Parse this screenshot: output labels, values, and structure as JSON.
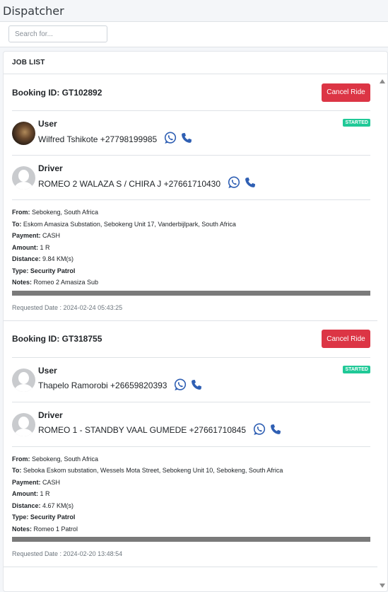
{
  "page": {
    "title": "Dispatcher"
  },
  "search": {
    "placeholder": "Search for..."
  },
  "job_list": {
    "header": "JOB LIST",
    "jobs": [
      {
        "booking_label": "Booking ID: GT102892",
        "cancel_label": "Cancel Ride",
        "status": "STARTED",
        "user": {
          "role": "User",
          "text": "Wilfred Tshikote +27798199985"
        },
        "driver": {
          "role": "Driver",
          "text": "ROMEO 2 WALAZA S / CHIRA J +27661710430"
        },
        "from_label": "From:",
        "from": " Sebokeng, South Africa",
        "to_label": "To:",
        "to": " Eskom Amasiza Substation, Sebokeng Unit 17, Vanderbijlpark, South Africa",
        "payment_label": "Payment:",
        "payment": " CASH",
        "amount_label": "Amount:",
        "amount": " 1 R",
        "distance_label": "Distance:",
        "distance": " 9.84 KM(s)",
        "type_label": "Type:",
        "type": " Security Patrol",
        "notes_label": "Notes:",
        "notes": " Romeo 2 Amasiza Sub",
        "progress_fraction": 1.0,
        "requested": "Requested Date : 2024-02-24 05:43:25"
      },
      {
        "booking_label": "Booking ID: GT318755",
        "cancel_label": "Cancel Ride",
        "status": "STARTED",
        "user": {
          "role": "User",
          "text": "Thapelo Ramorobi +26659820393"
        },
        "driver": {
          "role": "Driver",
          "text": "ROMEO 1 - STANDBY VAAL GUMEDE +27661710845"
        },
        "from_label": "From:",
        "from": " Sebokeng, South Africa",
        "to_label": "To:",
        "to": " Seboka Eskom substation, Wessels Mota Street, Sebokeng Unit 10, Sebokeng, South Africa",
        "payment_label": "Payment:",
        "payment": " CASH",
        "amount_label": "Amount:",
        "amount": " 1 R",
        "distance_label": "Distance:",
        "distance": " 4.67 KM(s)",
        "type_label": "Type:",
        "type": " Security Patrol",
        "notes_label": "Notes:",
        "notes": " Romeo 1 Patrol",
        "progress_fraction": 1.0,
        "requested": "Requested Date : 2024-02-20 13:48:54"
      }
    ]
  },
  "colors": {
    "cancel": "#dc3545",
    "badge": "#20c997",
    "icons": "#2f5fb3",
    "progress": "#7a7a7a"
  },
  "icons": {
    "whatsapp": "whatsapp-icon",
    "phone": "phone-icon"
  }
}
